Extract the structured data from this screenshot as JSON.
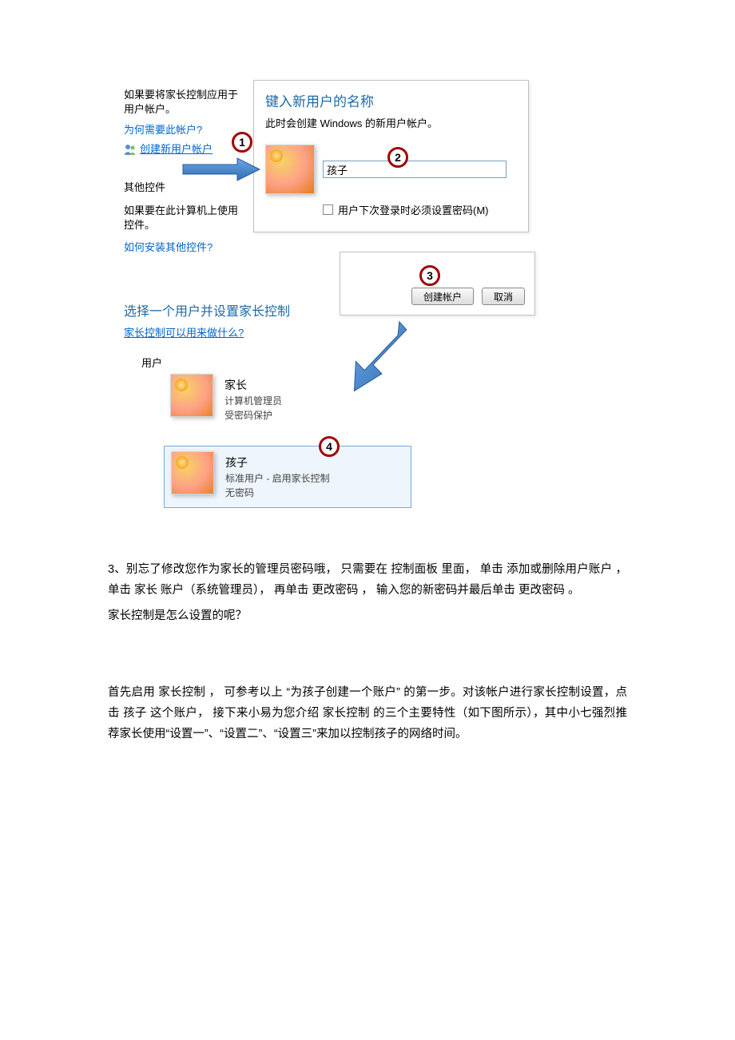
{
  "leftPanel": {
    "intro_l1": "如果要将家长控制应用于",
    "intro_l2": "用户帐户。",
    "why_link": "为何需要此帐户?",
    "create_link": "创建新用户帐户",
    "other_controls": "其他控件",
    "if_use_l1": "如果要在此计算机上使用",
    "if_use_l2": "控件。",
    "install_link": "如何安装其他控件?"
  },
  "dialog": {
    "title": "键入新用户的名称",
    "subtitle": "此时会创建 Windows 的新用户帐户。",
    "name_value": "孩子",
    "checkbox_label": "用户下次登录时必须设置密码(M)"
  },
  "buttons": {
    "create": "创建帐户",
    "cancel": "取消"
  },
  "selectSection": {
    "heading": "选择一个用户并设置家长控制",
    "what_link": "家长控制可以用来做什么?",
    "users_label": "用户"
  },
  "users": {
    "parent": {
      "name": "家长",
      "role": "计算机管理员",
      "protect": "受密码保护"
    },
    "child": {
      "name": "孩子",
      "role": "标准用户 - 启用家长控制",
      "nopass": "无密码"
    }
  },
  "badges": {
    "b1": "1",
    "b2": "2",
    "b3": "3",
    "b4": "4"
  },
  "body": {
    "p1": "3、别忘了修改您作为家长的管理员密码哦， 只需要在 控制面板 里面， 单击 添加或删除用户账户 ， 单击 家长 账户（系统管理员）， 再单击 更改密码 ， 输入您的新密码并最后单击 更改密码 。",
    "p2": "家长控制是怎么设置的呢？",
    "p3": "首先启用 家长控制 ， 可参考以上 “为孩子创建一个账户” 的第一步。对该帐户进行家长控制设置，点击 孩子 这个账户， 接下来小易为您介绍 家长控制 的三个主要特性（如下图所示），其中小七强烈推荐家长使用“设置一”、“设置二”、“设置三”来加以控制孩子的网络时间。"
  }
}
